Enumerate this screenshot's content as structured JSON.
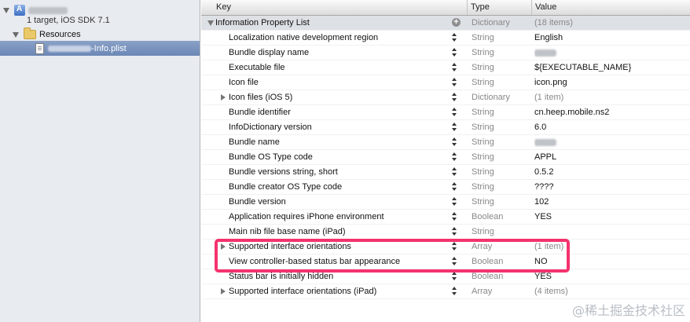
{
  "sidebar": {
    "project_subtitle": "1 target, iOS SDK 7.1",
    "folder_label": "Resources",
    "file_label": "-Info.plist"
  },
  "columns": {
    "key": "Key",
    "type": "Type",
    "value": "Value"
  },
  "rows": [
    {
      "key": "Information Property List",
      "type": "Dictionary",
      "value": "(18 items)",
      "kind": "root"
    },
    {
      "key": "Localization native development region",
      "type": "String",
      "value": "English"
    },
    {
      "key": "Bundle display name",
      "type": "String",
      "value": "",
      "redacted": true
    },
    {
      "key": "Executable file",
      "type": "String",
      "value": "${EXECUTABLE_NAME}"
    },
    {
      "key": "Icon file",
      "type": "String",
      "value": "icon.png"
    },
    {
      "key": "Icon files (iOS 5)",
      "type": "Dictionary",
      "value": "(1 item)",
      "kind": "collapsed"
    },
    {
      "key": "Bundle identifier",
      "type": "String",
      "value": "cn.heep.mobile.ns2"
    },
    {
      "key": "InfoDictionary version",
      "type": "String",
      "value": "6.0"
    },
    {
      "key": "Bundle name",
      "type": "String",
      "value": "",
      "redacted": true
    },
    {
      "key": "Bundle OS Type code",
      "type": "String",
      "value": "APPL"
    },
    {
      "key": "Bundle versions string, short",
      "type": "String",
      "value": "0.5.2"
    },
    {
      "key": "Bundle creator OS Type code",
      "type": "String",
      "value": "????"
    },
    {
      "key": "Bundle version",
      "type": "String",
      "value": "102"
    },
    {
      "key": "Application requires iPhone environment",
      "type": "Boolean",
      "value": "YES"
    },
    {
      "key": "Main nib file base name (iPad)",
      "type": "String",
      "value": ""
    },
    {
      "key": "Supported interface orientations",
      "type": "Array",
      "value": "(1 item)",
      "kind": "collapsed"
    },
    {
      "key": "View controller-based status bar appearance",
      "type": "Boolean",
      "value": "NO"
    },
    {
      "key": "Status bar is initially hidden",
      "type": "Boolean",
      "value": "YES"
    },
    {
      "key": "Supported interface orientations (iPad)",
      "type": "Array",
      "value": "(4 items)",
      "kind": "collapsed"
    }
  ],
  "watermark": "@稀土掘金技术社区",
  "colors": {
    "highlight": "#f4336e",
    "selection": "#6b87b6"
  }
}
